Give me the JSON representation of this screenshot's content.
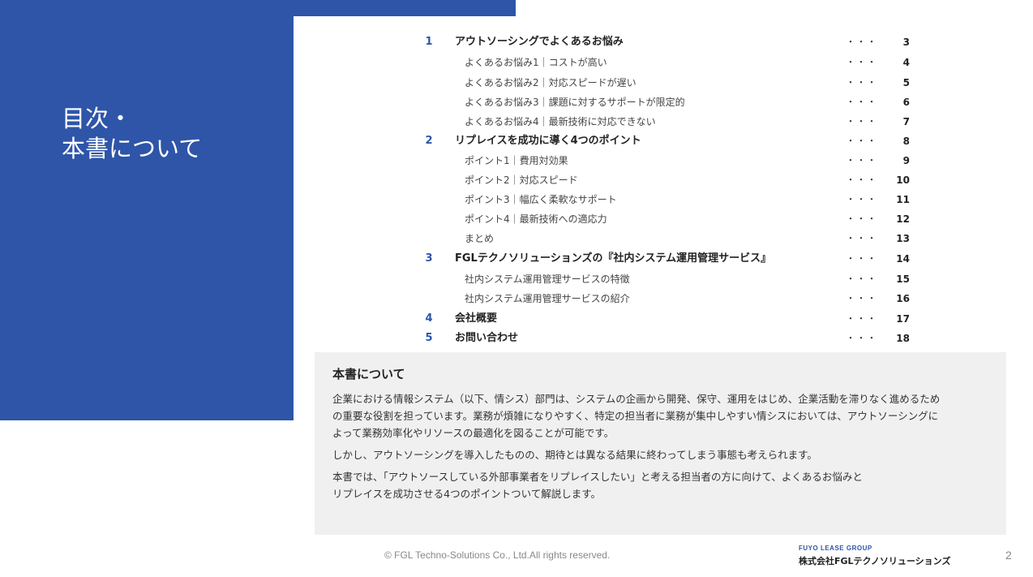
{
  "side": {
    "title_line1": "目次・",
    "title_line2": "本書について"
  },
  "toc": [
    {
      "num": "1",
      "label": "アウトソーシングでよくあるお悩み",
      "level": "main",
      "dots": "・・・",
      "page": "3"
    },
    {
      "num": "",
      "label": "よくあるお悩み1｜コストが高い",
      "level": "sub",
      "dots": "・・・",
      "page": "4"
    },
    {
      "num": "",
      "label": "よくあるお悩み2｜対応スピードが遅い",
      "level": "sub",
      "dots": "・・・",
      "page": "5"
    },
    {
      "num": "",
      "label": "よくあるお悩み3｜課題に対するサポートが限定的",
      "level": "sub",
      "dots": "・・・",
      "page": "6"
    },
    {
      "num": "",
      "label": "よくあるお悩み4｜最新技術に対応できない",
      "level": "sub",
      "dots": "・・・",
      "page": "7"
    },
    {
      "num": "2",
      "label": "リプレイスを成功に導く4つのポイント",
      "level": "main",
      "dots": "・・・",
      "page": "8"
    },
    {
      "num": "",
      "label": "ポイント1｜費用対効果",
      "level": "sub",
      "dots": "・・・",
      "page": "9"
    },
    {
      "num": "",
      "label": "ポイント2｜対応スピード",
      "level": "sub",
      "dots": "・・・",
      "page": "10"
    },
    {
      "num": "",
      "label": "ポイント3｜幅広く柔軟なサポート",
      "level": "sub",
      "dots": "・・・",
      "page": "11"
    },
    {
      "num": "",
      "label": "ポイント4｜最新技術への適応力",
      "level": "sub",
      "dots": "・・・",
      "page": "12"
    },
    {
      "num": "",
      "label": "まとめ",
      "level": "sub",
      "dots": "・・・",
      "page": "13"
    },
    {
      "num": "3",
      "label": "FGLテクノソリューションズの『社内システム運用管理サービス』",
      "level": "main",
      "dots": "・・・",
      "page": "14"
    },
    {
      "num": "",
      "label": "社内システム運用管理サービスの特徴",
      "level": "sub",
      "dots": "・・・",
      "page": "15"
    },
    {
      "num": "",
      "label": "社内システム運用管理サービスの紹介",
      "level": "sub",
      "dots": "・・・",
      "page": "16"
    },
    {
      "num": "4",
      "label": "会社概要",
      "level": "main",
      "dots": "・・・",
      "page": "17"
    },
    {
      "num": "5",
      "label": "お問い合わせ",
      "level": "main",
      "dots": "・・・",
      "page": "18"
    }
  ],
  "about": {
    "title": "本書について",
    "p1_line1": "企業における情報システム（以下、情シス）部門は、システムの企画から開発、保守、運用をはじめ、企業活動を滞りなく進めるため",
    "p1_line2": "の重要な役割を担っています。業務が煩雑になりやすく、特定の担当者に業務が集中しやすい情シスにおいては、アウトソーシングに",
    "p1_line3": "よって業務効率化やリソースの最適化を図ることが可能です。",
    "p2": "しかし、アウトソーシングを導入したものの、期待とは異なる結果に終わってしまう事態も考えられます。",
    "p3_line1": "本書では、「アウトソースしている外部事業者をリプレイスしたい」と考える担当者の方に向けて、よくあるお悩みと",
    "p3_line2": "リプレイスを成功させる4つのポイントついて解説します。"
  },
  "footer": {
    "copyright": "© FGL Techno-Solutions Co., Ltd.All rights reserved.",
    "group": "FUYO LEASE GROUP",
    "company": "株式会社FGLテクノソリューションズ",
    "page": "2"
  },
  "colors": {
    "brand_blue": "#2e55a8",
    "panel_gray": "#f0f0f0"
  }
}
